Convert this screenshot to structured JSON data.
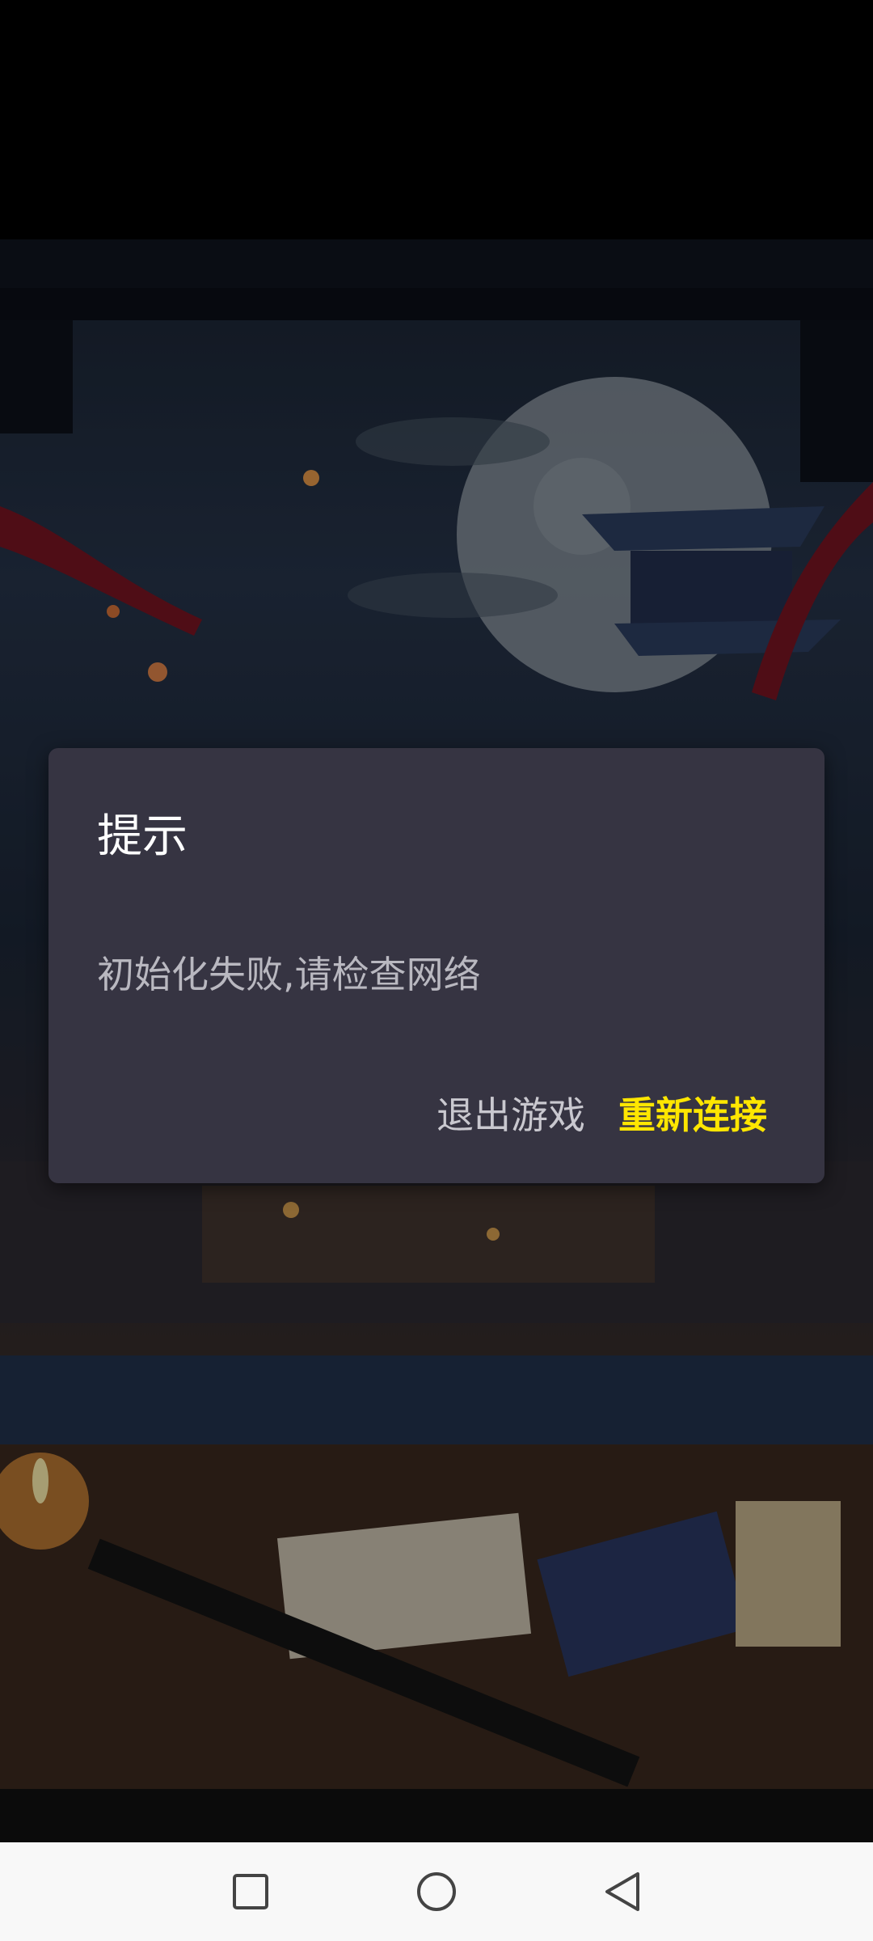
{
  "dialog": {
    "title": "提示",
    "message": "初始化失败,请检查网络",
    "exit_label": "退出游戏",
    "reconnect_label": "重新连接"
  },
  "colors": {
    "dialog_bg": "#363442",
    "reconnect": "#ffe600",
    "exit": "#c9c8cf"
  },
  "nav": {
    "recent_icon": "square-icon",
    "home_icon": "circle-icon",
    "back_icon": "triangle-back-icon"
  }
}
